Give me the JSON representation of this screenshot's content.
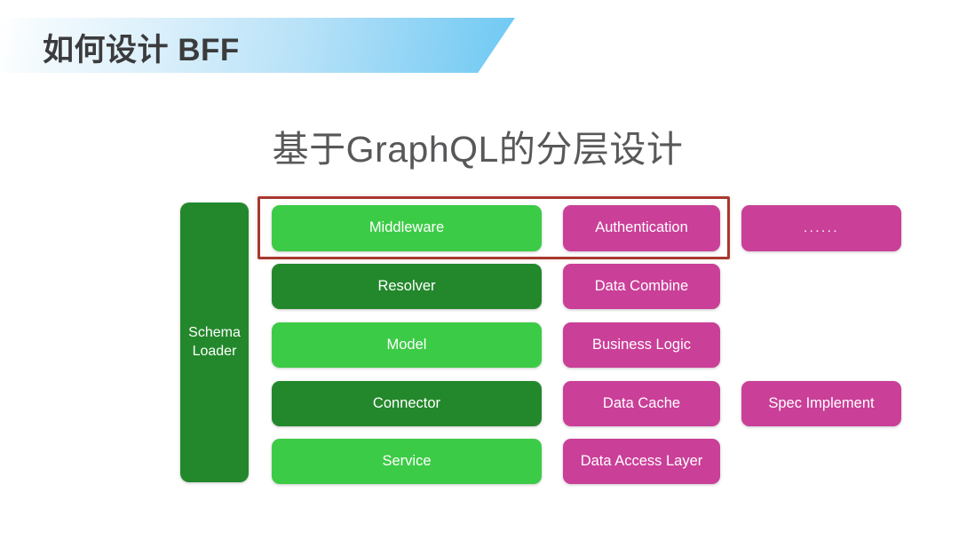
{
  "header": {
    "title": "如何设计 BFF",
    "banner_gradient_from": "#f6fbfe",
    "banner_gradient_to": "#6ec9f3",
    "title_color": "#3b3b3d"
  },
  "slide": {
    "title": "基于GraphQL的分层设计",
    "title_color": "#58585a",
    "background": "#ffffff"
  },
  "colors": {
    "green_light": "#3ccb46",
    "green_dark": "#23882c",
    "pink": "#ca3f98",
    "highlight_red": "#a8392f",
    "node_text": "#ffffff"
  },
  "diagram": {
    "type": "layered-architecture",
    "schema_loader": {
      "label": "Schema\nLoader",
      "color_role": "green_dark"
    },
    "columns": [
      {
        "name": "core-layers",
        "nodes": [
          {
            "label": "Middleware",
            "color_role": "green_light",
            "row": 1
          },
          {
            "label": "Resolver",
            "color_role": "green_dark",
            "row": 2
          },
          {
            "label": "Model",
            "color_role": "green_light",
            "row": 3
          },
          {
            "label": "Connector",
            "color_role": "green_dark",
            "row": 4
          },
          {
            "label": "Service",
            "color_role": "green_light",
            "row": 5
          }
        ]
      },
      {
        "name": "responsibilities",
        "nodes": [
          {
            "label": "Authentication",
            "color_role": "pink",
            "row": 1
          },
          {
            "label": "Data Combine",
            "color_role": "pink",
            "row": 2
          },
          {
            "label": "Business Logic",
            "color_role": "pink",
            "row": 3
          },
          {
            "label": "Data Cache",
            "color_role": "pink",
            "row": 4
          },
          {
            "label": "Data Access Layer",
            "color_role": "pink",
            "row": 5
          }
        ]
      },
      {
        "name": "extras",
        "nodes": [
          {
            "label": "......",
            "color_role": "pink",
            "row": 1
          },
          {
            "label": "Spec Implement",
            "color_role": "pink",
            "row": 4
          }
        ]
      }
    ],
    "highlight": {
      "label": "highlight around Middleware and Authentication row",
      "color": "#a8392f"
    }
  }
}
